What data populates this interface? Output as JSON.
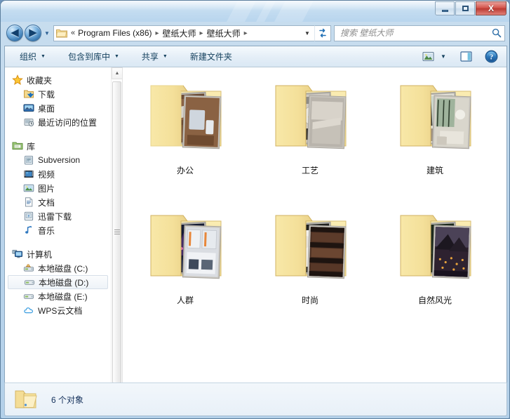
{
  "window": {
    "title": "",
    "controls": {
      "minimize_label": "–",
      "maximize_label": "□",
      "close_label": "X"
    }
  },
  "addressbar": {
    "back_label": "◀",
    "forward_label": "▶",
    "history_caret": "▼",
    "overflow": "«",
    "crumbs": [
      "Program Files (x86)",
      "壁纸大师",
      "壁纸大师"
    ],
    "crumb_separator": "▸",
    "dropdown_caret": "▼",
    "refresh_label": "↻"
  },
  "search": {
    "placeholder": "搜索 壁纸大师",
    "value": "",
    "icon": "search-icon"
  },
  "toolbar": {
    "items": [
      {
        "label": "组织",
        "has_caret": true
      },
      {
        "label": "包含到库中",
        "has_caret": true
      },
      {
        "label": "共享",
        "has_caret": true
      },
      {
        "label": "新建文件夹",
        "has_caret": false
      }
    ],
    "caret": "▼",
    "view_icon": "change-view-icon",
    "view_caret": "▼",
    "preview_pane_icon": "preview-pane-icon",
    "help_icon": "help-icon",
    "help_label": "?"
  },
  "sidebar": {
    "groups": [
      {
        "root": {
          "label": "收藏夹",
          "icon": "star-icon"
        },
        "items": [
          {
            "label": "下载",
            "icon": "downloads-icon"
          },
          {
            "label": "桌面",
            "icon": "desktop-icon"
          },
          {
            "label": "最近访问的位置",
            "icon": "recent-places-icon"
          }
        ]
      },
      {
        "root": {
          "label": "库",
          "icon": "library-icon"
        },
        "items": [
          {
            "label": "Subversion",
            "icon": "library-folder-icon"
          },
          {
            "label": "视频",
            "icon": "video-icon"
          },
          {
            "label": "图片",
            "icon": "pictures-icon"
          },
          {
            "label": "文档",
            "icon": "documents-icon"
          },
          {
            "label": "迅雷下载",
            "icon": "thunder-download-icon"
          },
          {
            "label": "音乐",
            "icon": "music-icon"
          }
        ]
      },
      {
        "root": {
          "label": "计算机",
          "icon": "computer-icon"
        },
        "items": [
          {
            "label": "本地磁盘 (C:)",
            "icon": "system-drive-icon",
            "selected": false
          },
          {
            "label": "本地磁盘 (D:)",
            "icon": "drive-icon",
            "selected": true
          },
          {
            "label": "本地磁盘 (E:)",
            "icon": "drive-icon",
            "selected": false
          },
          {
            "label": "WPS云文档",
            "icon": "cloud-icon",
            "selected": false
          }
        ]
      }
    ],
    "scrollbar": {
      "up_arrow": "▲",
      "down_arrow": "▼"
    }
  },
  "files": {
    "items": [
      {
        "name": "办公",
        "type": "folder",
        "thumb_a": "#6b4a33",
        "thumb_b": "#8a6243"
      },
      {
        "name": "工艺",
        "type": "folder",
        "thumb_a": "#cfcac2",
        "thumb_b": "#b9b4ac"
      },
      {
        "name": "建筑",
        "type": "folder",
        "thumb_a": "#9fb39c",
        "thumb_b": "#d9d6cc"
      },
      {
        "name": "人群",
        "type": "folder",
        "thumb_a": "#141a33",
        "thumb_b": "#dadde2"
      },
      {
        "name": "时尚",
        "type": "folder",
        "thumb_a": "#f2f0ec",
        "thumb_b": "#4a2f22"
      },
      {
        "name": "自然风光",
        "type": "folder",
        "thumb_a": "#1d2a1c",
        "thumb_b": "#2e2230"
      }
    ]
  },
  "statusbar": {
    "icon": "folder-icon",
    "text": "6 个对象"
  },
  "colors": {
    "folder_yellow": "#f6e49a",
    "folder_yellow_dark": "#e8d177",
    "accent_blue": "#2a5e92",
    "selection_border": "#d6dfe8",
    "close_red": "#bb3a32"
  }
}
